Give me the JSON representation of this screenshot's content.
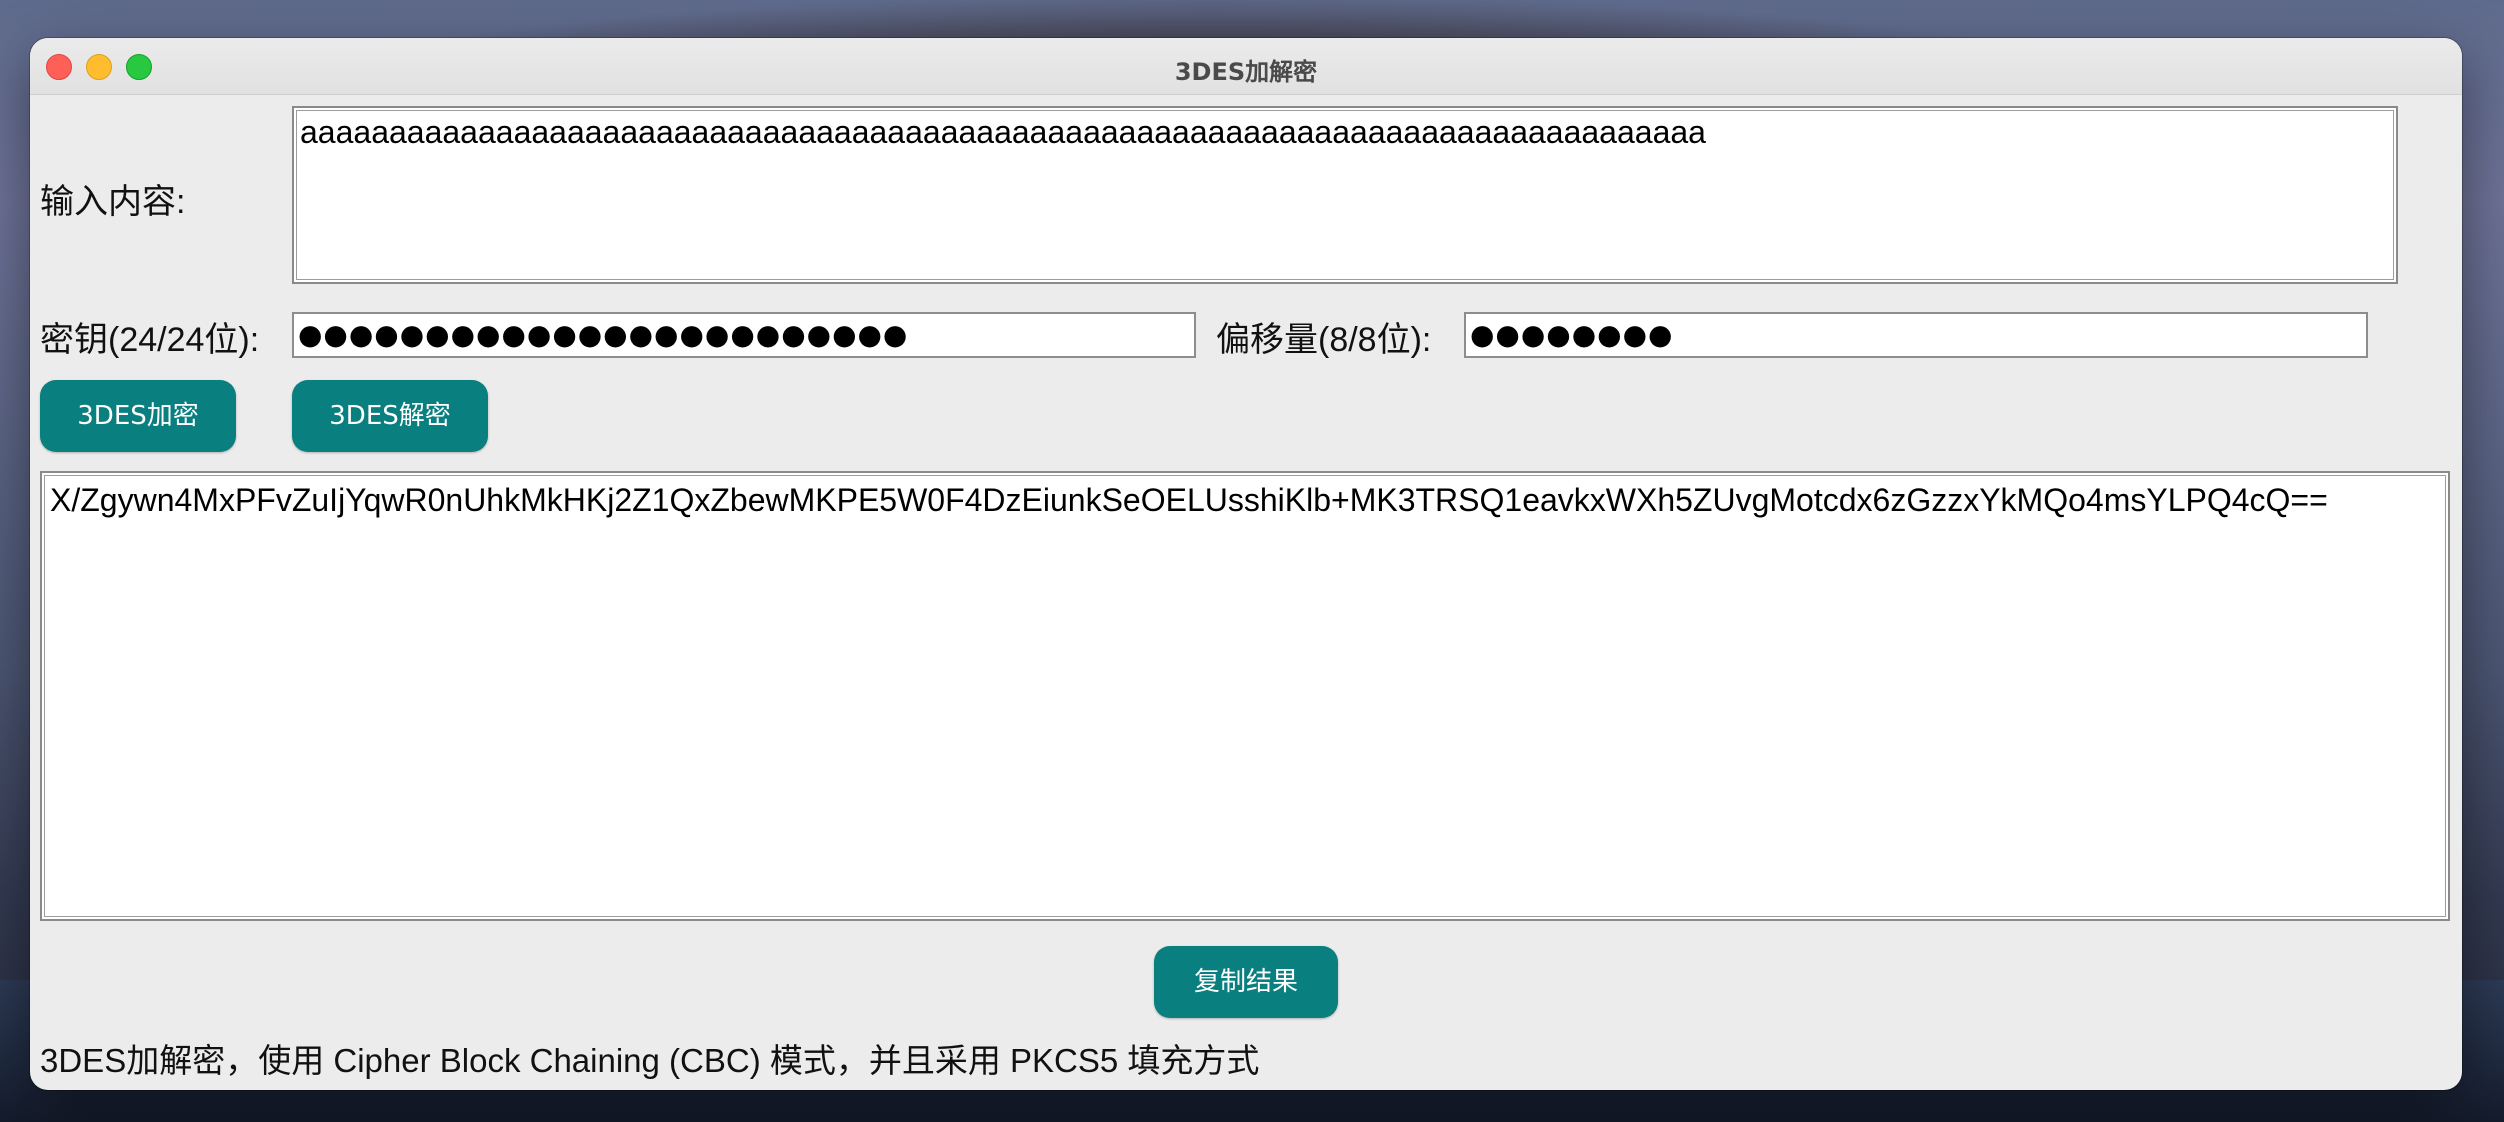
{
  "window": {
    "title": "3DES加解密"
  },
  "form": {
    "input_label": "输入内容:",
    "input_value": "aaaaaaaaaaaaaaaaaaaaaaaaaaaaaaaaaaaaaaaaaaaaaaaaaaaaaaaaaaaaaaaaaaaaaaaaaaaaaaa",
    "key_label": "密钥(24/24位):",
    "key_value": "●●●●●●●●●●●●●●●●●●●●●●●●",
    "iv_label": "偏移量(8/8位):",
    "iv_value": "●●●●●●●●"
  },
  "actions": {
    "encrypt_label": "3DES加密",
    "decrypt_label": "3DES解密",
    "copy_label": "复制结果"
  },
  "output": {
    "value": "X/Zgywn4MxPFvZuIjYqwR0nUhkMkHKj2Z1QxZbewMKPE5W0F4DzEiunkSeOELUsshiKlb+MK3TRSQ1eavkxWXh5ZUvgMotcdx6zGzzxYkMQo4msYLPQ4cQ=="
  },
  "footer": {
    "note": "3DES加解密，使用 Cipher Block Chaining (CBC) 模式，并且采用 PKCS5 填充方式"
  },
  "colors": {
    "button_bg": "#0a7f7f",
    "window_bg": "#ececec"
  }
}
